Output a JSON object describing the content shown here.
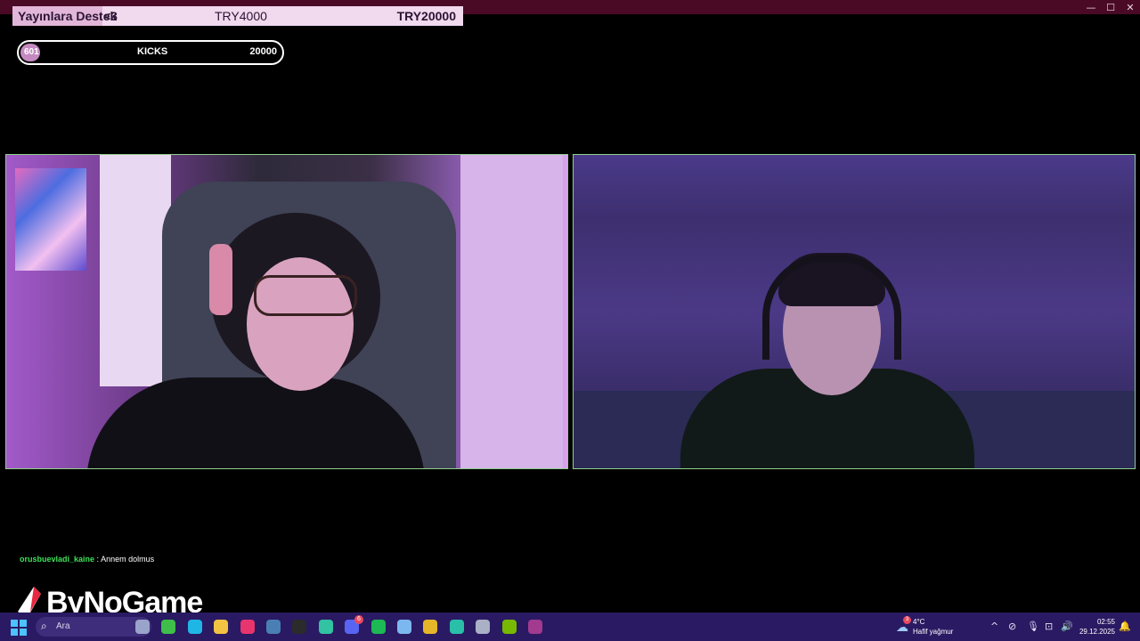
{
  "window": {
    "controls": {
      "minimize": "—",
      "maximize": "☐",
      "close": "✕"
    }
  },
  "support_goal": {
    "label": "Yayınlara Destek",
    "heart": "<3",
    "current": "TRY4000",
    "goal": "TRY20000",
    "progress_fraction": 0.2
  },
  "kicks_goal": {
    "count": "601",
    "label": "KICKS",
    "goal": "20000",
    "progress_fraction": 0.03
  },
  "chat": {
    "username": "orusbuevladi_kaine",
    "separator": " : ",
    "message": "Annem dolmus"
  },
  "logo": {
    "text": "ByNoGame"
  },
  "taskbar": {
    "search_placeholder": "Ara",
    "apps": [
      {
        "name": "taskview-icon",
        "color": "#9aa3c9"
      },
      {
        "name": "xbox-icon",
        "color": "#3fbf4a"
      },
      {
        "name": "edge-icon",
        "color": "#1fb6e6"
      },
      {
        "name": "file-explorer-icon",
        "color": "#f2c343"
      },
      {
        "name": "opera-gx-icon",
        "color": "#e8356d"
      },
      {
        "name": "steam-icon",
        "color": "#4a7fb5"
      },
      {
        "name": "obs-icon",
        "color": "#2b2b2b"
      },
      {
        "name": "streamlabs-icon",
        "color": "#31c3a2"
      },
      {
        "name": "discord-icon",
        "color": "#5865f2",
        "badge": "6"
      },
      {
        "name": "spotify-icon",
        "color": "#1db954"
      },
      {
        "name": "gamepad-app-icon",
        "color": "#7db7ef"
      },
      {
        "name": "chrome-icon",
        "color": "#e6b629"
      },
      {
        "name": "chatterino-icon",
        "color": "#29bfa8"
      },
      {
        "name": "settings-icon",
        "color": "#aab0c6"
      },
      {
        "name": "nvidia-icon",
        "color": "#76b900"
      },
      {
        "name": "winrar-icon",
        "color": "#a23a8f"
      }
    ],
    "weather": {
      "badge": "3",
      "temp": "4°C",
      "condition": "Hafif yağmur"
    },
    "tray_icons": [
      "^",
      "⊘",
      "🎙",
      "⊡",
      "🔊"
    ],
    "time": "02:55",
    "date": "29.12.2025",
    "notification_icon": "🔔"
  }
}
